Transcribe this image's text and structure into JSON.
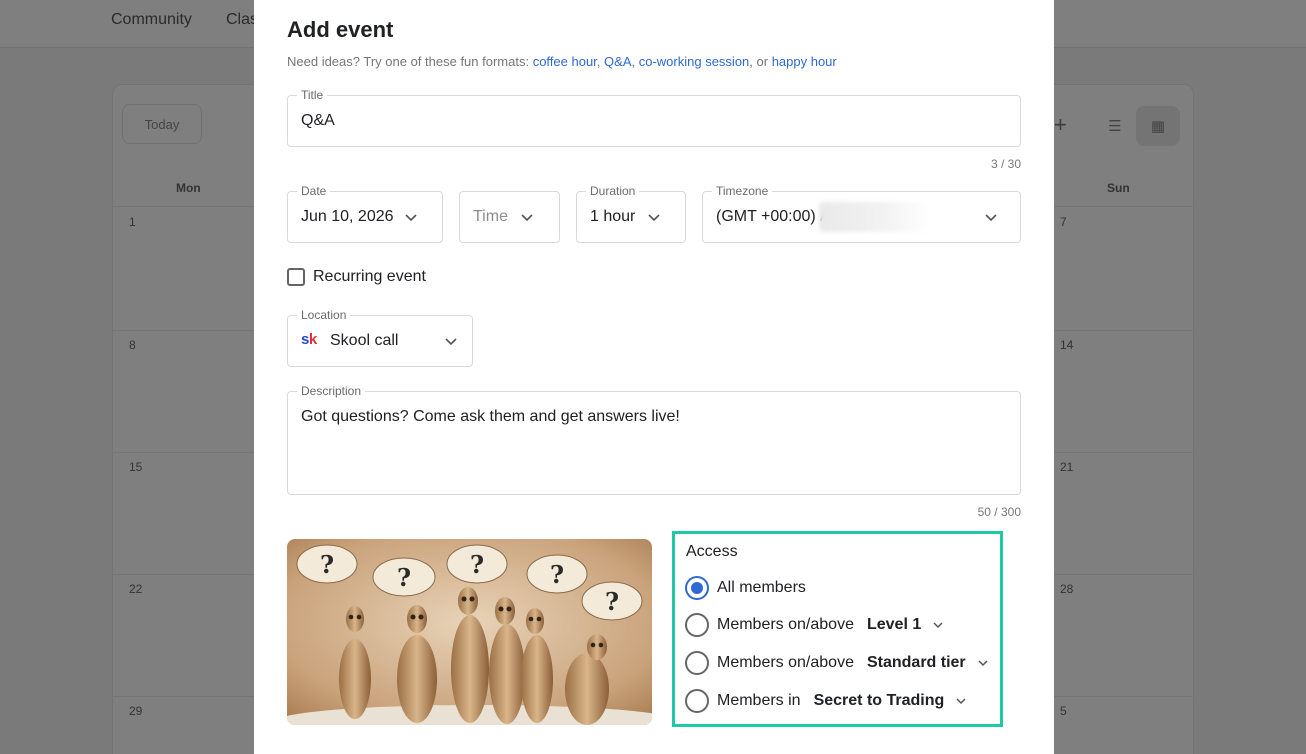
{
  "background": {
    "nav": [
      "Community",
      "Clas"
    ],
    "today_label": "Today",
    "weekdays": {
      "mon": "Mon",
      "sun": "Sun"
    },
    "day_numbers_left": [
      "1",
      "8",
      "15",
      "22",
      "29"
    ],
    "day_numbers_right": [
      "7",
      "14",
      "21",
      "28",
      "5"
    ]
  },
  "modal": {
    "title": "Add event",
    "ideas": {
      "prefix": "Need ideas? Try one of these fun formats: ",
      "link1": "coffee hour",
      "sep1": ", ",
      "link2": "Q&A",
      "sep2": ", ",
      "link3": "co-working session",
      "sep3": ", or ",
      "link4": "happy hour"
    },
    "title_field": {
      "label": "Title",
      "value": "Q&A",
      "counter": "3 / 30"
    },
    "date_field": {
      "label": "Date",
      "value": "Jun 10, 2026"
    },
    "time_field": {
      "placeholder": "Time"
    },
    "duration_field": {
      "label": "Duration",
      "value": "1 hour"
    },
    "timezone_field": {
      "label": "Timezone",
      "value": "(GMT +00:00) /"
    },
    "recurring": {
      "label": "Recurring event",
      "checked": false
    },
    "location_field": {
      "label": "Location",
      "logo_s": "s",
      "logo_k": "k",
      "value": "Skool call"
    },
    "description_field": {
      "label": "Description",
      "value": "Got questions? Come ask them and get answers live!",
      "counter": "50 / 300"
    },
    "image": {
      "marks": [
        "?",
        "?",
        "?",
        "?",
        "?"
      ]
    },
    "access": {
      "title": "Access",
      "options": [
        {
          "label": "All members",
          "selected": true
        },
        {
          "label": "Members on/above",
          "select": "Level 1",
          "selected": false
        },
        {
          "label": "Members on/above",
          "select": "Standard tier",
          "selected": false
        },
        {
          "label": "Members in",
          "select": "Secret to Trading",
          "selected": false
        }
      ],
      "highlight_color": "#1ec9a4"
    },
    "link_color": "#2e69d4"
  }
}
